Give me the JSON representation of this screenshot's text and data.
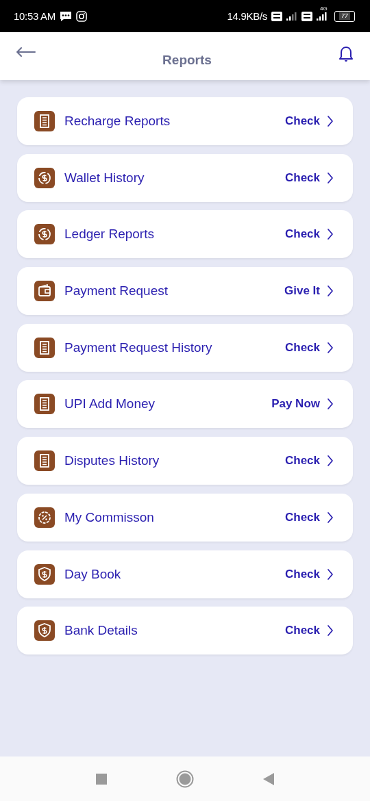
{
  "status_bar": {
    "time": "10:53 AM",
    "speed": "14.9KB/s",
    "network": "4G",
    "battery": "77"
  },
  "header": {
    "title": "Reports"
  },
  "items": [
    {
      "label": "Recharge Reports",
      "action": "Check",
      "kind": "receipt"
    },
    {
      "label": "Wallet History",
      "action": "Check",
      "kind": "exchange"
    },
    {
      "label": "Ledger Reports",
      "action": "Check",
      "kind": "exchange"
    },
    {
      "label": "Payment Request",
      "action": "Give It",
      "kind": "wallet"
    },
    {
      "label": "Payment Request History",
      "action": "Check",
      "kind": "receipt"
    },
    {
      "label": "UPI Add Money",
      "action": "Pay Now",
      "kind": "receipt"
    },
    {
      "label": "Disputes History",
      "action": "Check",
      "kind": "receipt"
    },
    {
      "label": "My Commisson",
      "action": "Check",
      "kind": "percent"
    },
    {
      "label": "Day Book",
      "action": "Check",
      "kind": "shield"
    },
    {
      "label": "Bank Details",
      "action": "Check",
      "kind": "shield"
    }
  ]
}
